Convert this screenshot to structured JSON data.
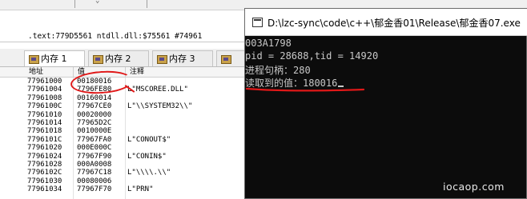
{
  "debugger": {
    "info_line": ".text:779D5561 ntdll.dll:$75561 #74961",
    "tabs": [
      {
        "label": "内存 1",
        "icon": "memory-icon"
      },
      {
        "label": "内存 2",
        "icon": "memory-icon"
      },
      {
        "label": "内存 3",
        "icon": "memory-icon"
      }
    ],
    "columns": {
      "address": "地址",
      "value": "值",
      "comment": "注释"
    },
    "rows": [
      {
        "addr": "77961000",
        "value": "00180016",
        "comment": ""
      },
      {
        "addr": "77961004",
        "value": "7796FE80",
        "comment": "L\"MSCOREE.DLL\""
      },
      {
        "addr": "77961008",
        "value": "00160014",
        "comment": ""
      },
      {
        "addr": "7796100C",
        "value": "77967CE0",
        "comment": "L\"\\\\SYSTEM32\\\\\""
      },
      {
        "addr": "77961010",
        "value": "00020000",
        "comment": ""
      },
      {
        "addr": "77961014",
        "value": "77965D2C",
        "comment": ""
      },
      {
        "addr": "77961018",
        "value": "0010000E",
        "comment": ""
      },
      {
        "addr": "7796101C",
        "value": "77967FA0",
        "comment": "L\"CONOUT$\""
      },
      {
        "addr": "77961020",
        "value": "000E000C",
        "comment": ""
      },
      {
        "addr": "77961024",
        "value": "77967F90",
        "comment": "L\"CONIN$\""
      },
      {
        "addr": "77961028",
        "value": "000A0008",
        "comment": ""
      },
      {
        "addr": "7796102C",
        "value": "77967C18",
        "comment": "L\"\\\\\\\\.\\\\\""
      },
      {
        "addr": "77961030",
        "value": "00080006",
        "comment": ""
      },
      {
        "addr": "77961034",
        "value": "77967F70",
        "comment": "L\"PRN\""
      }
    ]
  },
  "console": {
    "title": "D:\\lzc-sync\\code\\c++\\郁金香01\\Release\\郁金香07.exe",
    "lines": [
      "003A1798",
      "pid = 28688,tid = 14920",
      "进程句柄：280",
      "读取到的值：180016"
    ]
  },
  "annotation_color": "#e01818",
  "watermark": "iocaop.com"
}
